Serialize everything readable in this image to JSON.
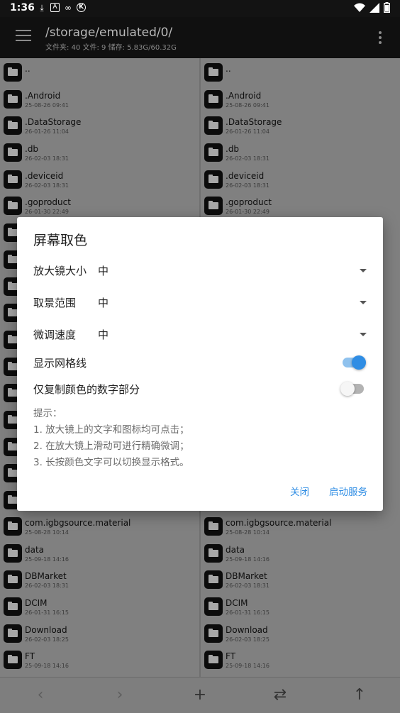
{
  "status_bar": {
    "time": "1:36",
    "notif_icons": [
      "download-icon",
      "a-icon",
      "loop-icon",
      "k-icon"
    ],
    "sys_icons": [
      "wifi-icon",
      "signal-icon",
      "battery-icon"
    ]
  },
  "app_bar": {
    "path": "/storage/emulated/0/",
    "stats": "文件夹: 40  文件: 9  储存: 5.83G/60.32G"
  },
  "left_pane": {
    "top_rows": [
      {
        "name": "..",
        "date": ""
      },
      {
        "name": ".Android",
        "date": "25-08-26 09:41"
      },
      {
        "name": ".DataStorage",
        "date": "26-01-26 11:04"
      },
      {
        "name": ".db",
        "date": "26-02-03 18:31"
      },
      {
        "name": ".deviceid",
        "date": "26-02-03 18:31"
      },
      {
        "name": ".goproduct",
        "date": "26-01-30 22:49"
      }
    ],
    "bottom_rows": [
      {
        "name": "com.igbgsource.material",
        "date": "25-08-28 10:14"
      },
      {
        "name": "data",
        "date": "25-09-18 14:16"
      },
      {
        "name": "DBMarket",
        "date": "26-02-03 18:31"
      },
      {
        "name": "DCIM",
        "date": "26-01-31 16:15"
      },
      {
        "name": "Download",
        "date": "26-02-03 18:25"
      },
      {
        "name": "FT",
        "date": "25-09-18 14:16"
      }
    ]
  },
  "right_pane": {
    "top_rows": [
      {
        "name": "..",
        "date": ""
      },
      {
        "name": ".Android",
        "date": "25-08-26 09:41"
      },
      {
        "name": ".DataStorage",
        "date": "26-01-26 11:04"
      },
      {
        "name": ".db",
        "date": "26-02-03 18:31"
      },
      {
        "name": ".deviceid",
        "date": "26-02-03 18:31"
      },
      {
        "name": ".goproduct",
        "date": "26-01-30 22:49"
      }
    ],
    "bottom_rows": [
      {
        "name": "com.igbgsource.material",
        "date": "25-08-28 10:14"
      },
      {
        "name": "data",
        "date": "25-09-18 14:16"
      },
      {
        "name": "DBMarket",
        "date": "26-02-03 18:31"
      },
      {
        "name": "DCIM",
        "date": "26-01-31 16:15"
      },
      {
        "name": "Download",
        "date": "26-02-03 18:25"
      },
      {
        "name": "FT",
        "date": "25-09-18 14:16"
      }
    ]
  },
  "dialog": {
    "title": "屏幕取色",
    "magnifier_size": {
      "label": "放大镜大小",
      "value": "中"
    },
    "capture_range": {
      "label": "取景范围",
      "value": "中"
    },
    "fine_tune_speed": {
      "label": "微调速度",
      "value": "中"
    },
    "show_grid": {
      "label": "显示网格线",
      "on": true
    },
    "copy_digits_only": {
      "label": "仅复制颜色的数字部分",
      "on": false
    },
    "tips": [
      "提示：",
      "1. 放大镜上的文字和图标均可点击；",
      "2. 在放大镜上滑动可进行精确微调；",
      "3. 长按颜色文字可以切换显示格式。"
    ],
    "close_label": "关闭",
    "start_label": "启动服务",
    "accent_color": "#2f8de4"
  },
  "bottom_bar": {
    "icons": [
      "back-icon",
      "forward-icon",
      "add-icon",
      "swap-icon",
      "up-icon"
    ]
  }
}
